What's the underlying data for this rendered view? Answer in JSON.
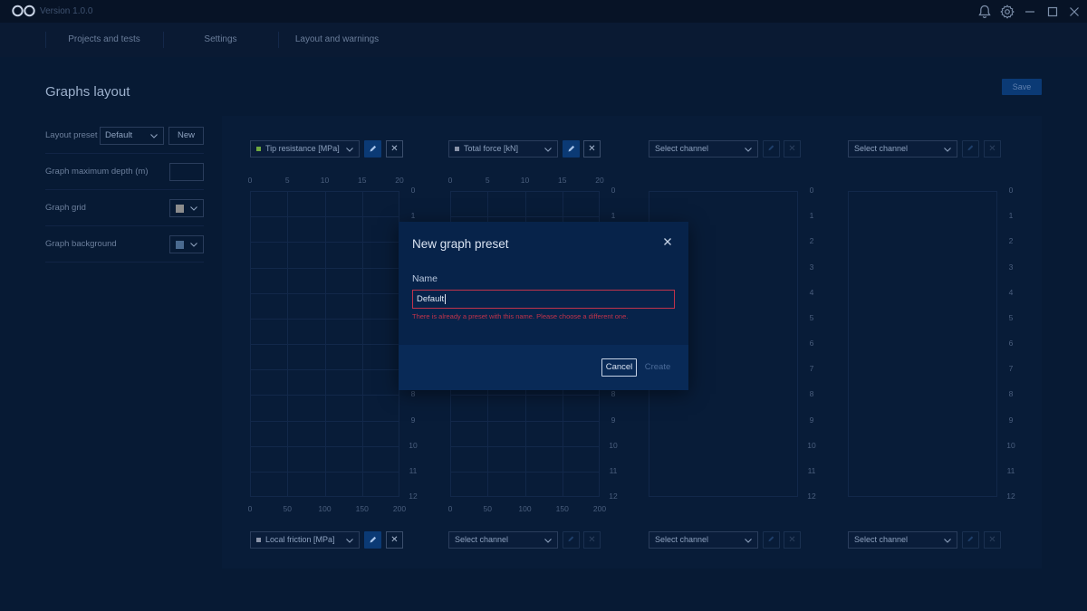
{
  "app": {
    "version": "Version 1.0.0"
  },
  "nav": {
    "items": [
      "Projects and tests",
      "Settings",
      "Layout and warnings"
    ]
  },
  "page": {
    "title": "Graphs layout",
    "save_label": "Save"
  },
  "settings": {
    "layout_preset": {
      "label": "Layout preset",
      "value": "Default",
      "new_label": "New"
    },
    "max_depth": {
      "label": "Graph maximum depth (m)",
      "value": ""
    },
    "grid": {
      "label": "Graph grid",
      "color": "#8c8c8c"
    },
    "background": {
      "label": "Graph background",
      "color": "#4a6a8f"
    }
  },
  "graphs": {
    "top_channels": [
      "Tip resistance [MPa]",
      "Total force [kN]",
      "Select channel",
      "Select channel"
    ],
    "bottom_channels": [
      "Local friction [MPa]",
      "Select channel",
      "Select channel",
      "Select channel"
    ],
    "channel_colors": {
      "tip": "#6fa840",
      "force": "#8a93a8",
      "friction": "#8a93a8"
    },
    "top_axis_ticks": [
      "0",
      "5",
      "10",
      "15",
      "20"
    ],
    "bottom_axis_ticks": [
      "0",
      "50",
      "100",
      "150",
      "200"
    ],
    "depth_ticks": [
      "0",
      "1",
      "2",
      "3",
      "4",
      "5",
      "6",
      "7",
      "8",
      "9",
      "10",
      "11",
      "12"
    ]
  },
  "modal": {
    "title": "New graph preset",
    "name_label": "Name",
    "name_value": "Default",
    "error": "There is already a preset with this name. Please choose a different one.",
    "cancel_label": "Cancel",
    "create_label": "Create"
  }
}
